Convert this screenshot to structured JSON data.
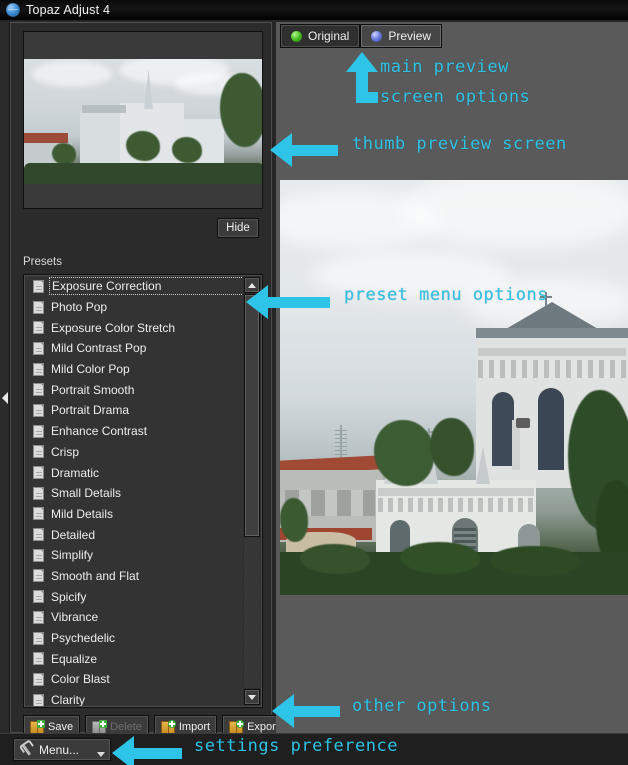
{
  "window": {
    "title": "Topaz Adjust 4",
    "icon": "globe-icon"
  },
  "left_panel": {
    "thumbnail": {
      "name": "thumbnail-preview",
      "description": "Church building photograph thumbnail"
    },
    "hide_button": "Hide",
    "presets_label": "Presets",
    "presets": [
      "Exposure Correction",
      "Photo Pop",
      "Exposure Color Stretch",
      "Mild Contrast Pop",
      "Mild Color Pop",
      "Portrait Smooth",
      "Portrait Drama",
      "Enhance Contrast",
      "Crisp",
      "Dramatic",
      "Small Details",
      "Mild Details",
      "Detailed",
      "Simplify",
      "Smooth and Flat",
      "Spicify",
      "Vibrance",
      "Psychedelic",
      "Equalize",
      "Color Blast",
      "Clarity"
    ],
    "selected_preset": "Exposure Correction",
    "toolbar": [
      {
        "label": "Save",
        "icon": "save-box-icon",
        "enabled": true
      },
      {
        "label": "Delete",
        "icon": "delete-box-icon",
        "enabled": false
      },
      {
        "label": "Import",
        "icon": "import-box-icon",
        "enabled": true
      },
      {
        "label": "Export",
        "icon": "export-box-icon",
        "enabled": true
      }
    ],
    "menu_button": {
      "label": "Menu...",
      "icon": "wrench-icon",
      "caret": "chevron-down-icon"
    },
    "collapse_handle": "collapse-left-arrow-icon"
  },
  "right_panel": {
    "tabs": [
      {
        "label": "Original",
        "dot": "green-status-dot",
        "active": false
      },
      {
        "label": "Preview",
        "dot": "blue-status-dot",
        "active": true
      }
    ],
    "main_image": {
      "name": "main-preview-image",
      "description": "Church building photograph preview"
    }
  },
  "annotations": [
    {
      "id": "main-preview",
      "text": "main preview",
      "arrow": "up"
    },
    {
      "id": "screen-options",
      "text": "screen options",
      "arrow": "none"
    },
    {
      "id": "thumb-preview",
      "text": "thumb preview screen",
      "arrow": "left"
    },
    {
      "id": "preset-menu",
      "text": "preset menu options",
      "arrow": "left"
    },
    {
      "id": "other-options",
      "text": "other options",
      "arrow": "left"
    },
    {
      "id": "settings-pref",
      "text": "settings preference",
      "arrow": "left"
    }
  ],
  "colors": {
    "annotation": "#2ec4e8",
    "title_bar": "#0a0a0a",
    "panel_bg": "#2b2b2b",
    "right_bg": "#5a5a5a",
    "text": "#ededed"
  }
}
